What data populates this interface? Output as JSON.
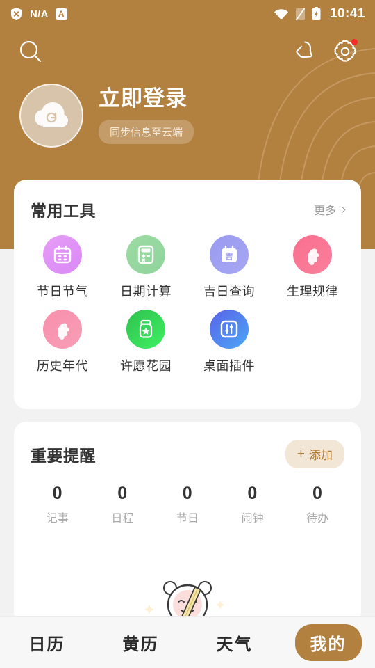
{
  "theme": {
    "brand_brown": "#b2803f",
    "page_bg": "#f2f2f2",
    "card_bg": "#ffffff",
    "badge_red": "#f42c2c",
    "add_pill_bg": "#f2e6d6",
    "add_pill_text": "#b07a35"
  },
  "statusbar": {
    "shield_icon": "shield-x-icon",
    "carrier": "N/A",
    "app_icon_letter": "A",
    "wifi_icon": "wifi-icon",
    "sim_icon": "sim-off-icon",
    "battery_icon": "battery-charging-icon",
    "time": "10:41"
  },
  "topbar": {
    "search_icon": "search-icon",
    "notification_icon": "bell-icon",
    "settings_icon": "gear-icon",
    "settings_has_badge": true
  },
  "profile": {
    "avatar_icon": "cloud-sync-icon",
    "title": "立即登录",
    "subtitle": "同步信息至云端"
  },
  "tools_card": {
    "title": "常用工具",
    "more_label": "更多",
    "more_icon": "chevron-right-icon",
    "items": [
      {
        "label": "节日节气",
        "icon": "calendar-icon",
        "c1": "#e69ef5",
        "c2": "#d988f7"
      },
      {
        "label": "日期计算",
        "icon": "calculator-icon",
        "c1": "#9ddba3",
        "c2": "#8fd49b"
      },
      {
        "label": "吉日查询",
        "icon": "lucky-calendar-icon",
        "c1": "#9a9bf0",
        "c2": "#a7a6f4"
      },
      {
        "label": "生理规律",
        "icon": "woman-figure-icon",
        "c1": "#f9708e",
        "c2": "#f97f9b"
      },
      {
        "label": "历史年代",
        "icon": "woman-figure-icon",
        "c1": "#f98fac",
        "c2": "#f79eb6"
      },
      {
        "label": "许愿花园",
        "icon": "wish-jar-icon",
        "c1": "#2fc14f",
        "c2": "#3ff062"
      },
      {
        "label": "桌面插件",
        "icon": "widget-slider-icon",
        "c1": "#5a63e8",
        "c2": "#4ba6f5"
      }
    ]
  },
  "reminder_card": {
    "title": "重要提醒",
    "add_label": "添加",
    "add_icon": "plus-icon",
    "stats": [
      {
        "count": "0",
        "label": "记事"
      },
      {
        "count": "0",
        "label": "日程"
      },
      {
        "count": "0",
        "label": "节日"
      },
      {
        "count": "0",
        "label": "闹钟"
      },
      {
        "count": "0",
        "label": "待办"
      }
    ],
    "empty_illustration": "alarm-clock-pencil-illustration"
  },
  "bottomnav": {
    "items": [
      {
        "label": "日历",
        "active": false
      },
      {
        "label": "黄历",
        "active": false
      },
      {
        "label": "天气",
        "active": false
      },
      {
        "label": "我的",
        "active": true
      }
    ]
  }
}
